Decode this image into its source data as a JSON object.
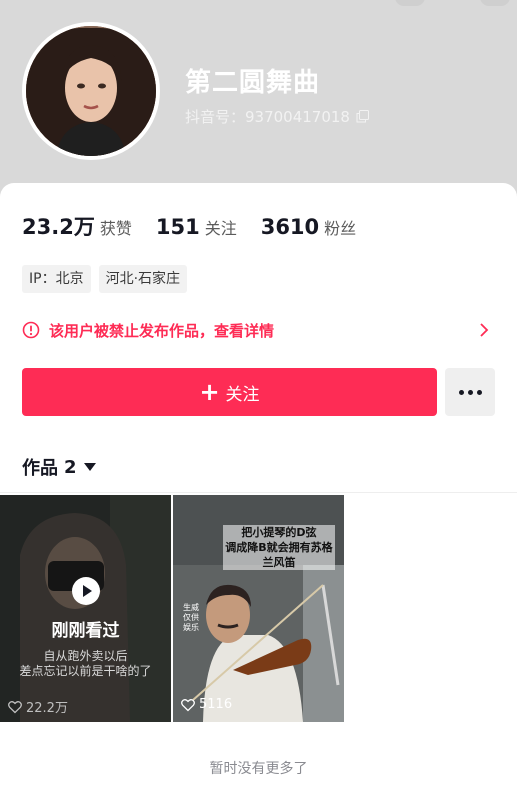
{
  "profile": {
    "nickname": "第二圆舞曲",
    "account_id": "抖音号：93700417018"
  },
  "stats": [
    {
      "value": "23.2万",
      "label": "获赞"
    },
    {
      "value": "151",
      "label": "关注"
    },
    {
      "value": "3610",
      "label": "粉丝"
    }
  ],
  "tags": [
    "IP：北京",
    "河北·石家庄"
  ],
  "ban_notice": {
    "text": "该用户被禁止发布作品，查看详情",
    "color": "#fe2c55"
  },
  "follow_button": {
    "label": "关注",
    "color": "#fe2c55"
  },
  "works": {
    "label": "作品",
    "count": "2"
  },
  "videos": [
    {
      "overlay_label": "刚刚看过",
      "caption_line1": "自从跑外卖以后",
      "caption_line2": "差点忘记以前是干啥的了",
      "likes": "22.2万"
    },
    {
      "title_line1": "把小提琴的D弦",
      "title_line2": "调成降B就会拥有苏格",
      "title_line3": "兰风笛",
      "side_text": "生威 仅供娱乐",
      "likes": "5116"
    }
  ],
  "footer": "暂时没有更多了",
  "icons": {
    "copy": "copy-icon",
    "warning": "warning-circle-icon",
    "arrow": "chevron-right-icon",
    "plus": "plus-icon",
    "more": "more-dots-icon",
    "caret": "caret-down-icon",
    "play": "play-icon",
    "heart": "heart-icon"
  }
}
